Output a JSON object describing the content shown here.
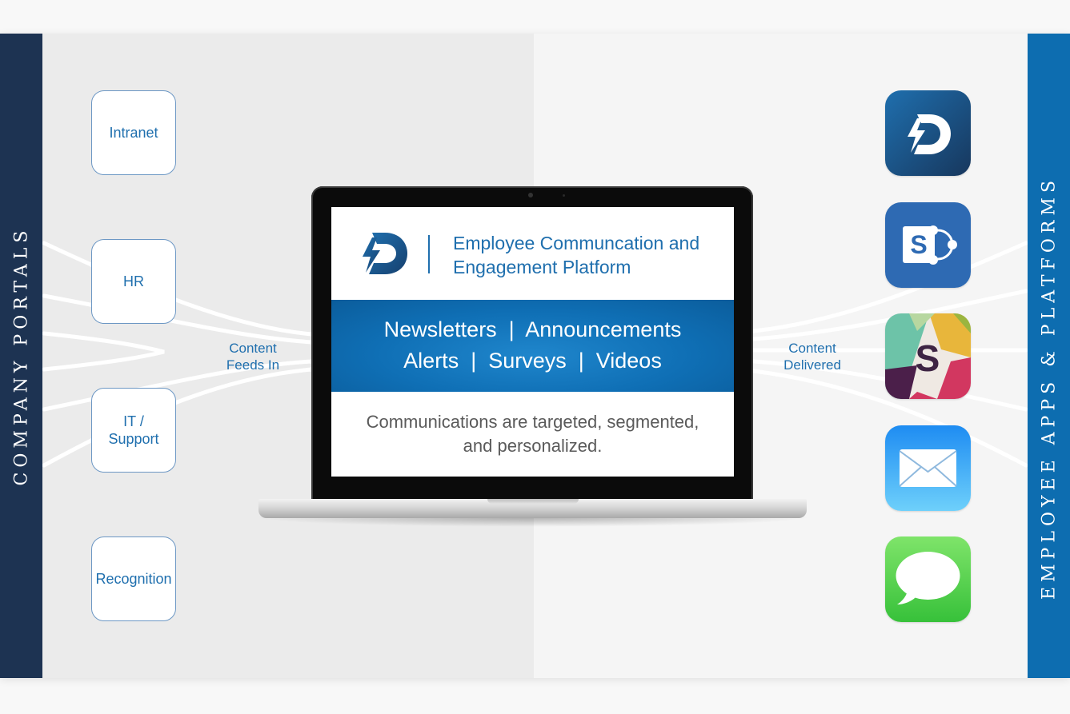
{
  "left_rail": {
    "label": "COMPANY PORTALS"
  },
  "right_rail": {
    "label": "EMPLOYEE APPS & PLATFORMS"
  },
  "portals": [
    {
      "label": "Intranet"
    },
    {
      "label": "HR"
    },
    {
      "label": "IT /\nSupport"
    },
    {
      "label": "Recognition"
    }
  ],
  "flow_labels": {
    "in": "Content\nFeeds In",
    "out": "Content\nDelivered"
  },
  "laptop_screen": {
    "title": "Employee Communcation and\nEngagement Platform",
    "banner_line_1": "Newsletters  |  Announcements",
    "banner_line_2": "Alerts  |  Surveys  |  Videos",
    "description": "Communications are targeted, segmented,\nand personalized."
  },
  "apps": [
    {
      "icon": "dynamic-signal-app-icon"
    },
    {
      "icon": "sharepoint-app-icon"
    },
    {
      "icon": "slack-app-icon"
    },
    {
      "icon": "mail-app-icon"
    },
    {
      "icon": "messages-app-icon"
    }
  ],
  "colors": {
    "navy": "#1d3352",
    "brand_blue": "#0d6db0",
    "text_blue": "#1f6fae"
  }
}
